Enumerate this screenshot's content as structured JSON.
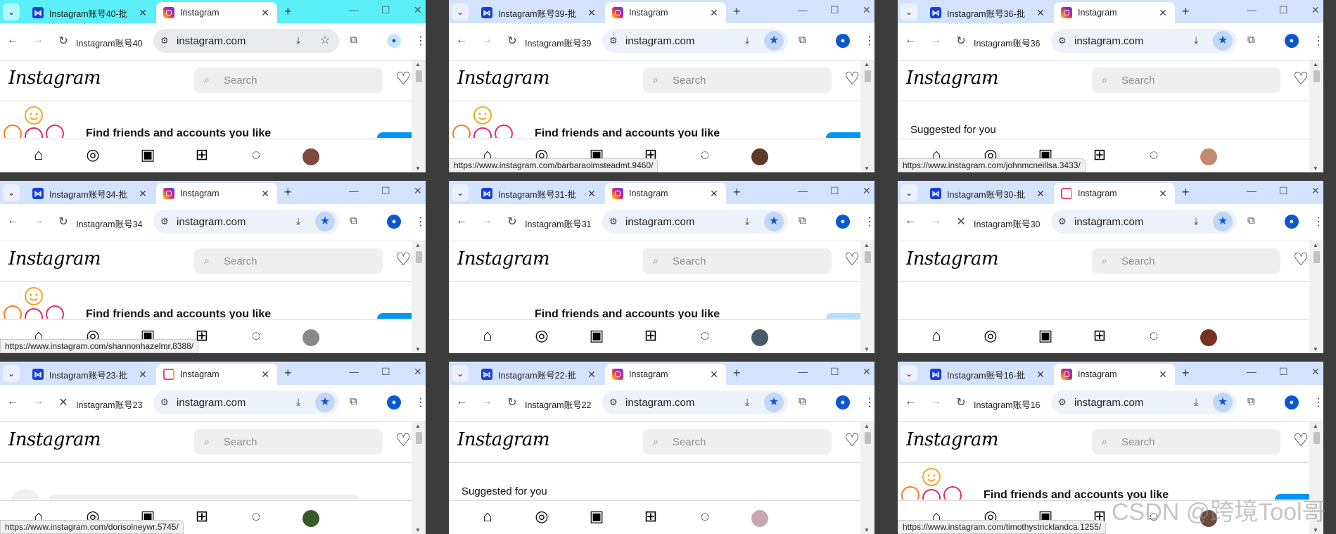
{
  "common": {
    "new_tab_glyph": "+",
    "close_glyph": "✕",
    "menu_glyph": "⌄",
    "back_glyph": "←",
    "forward_glyph": "→",
    "reload_glyph": "↻",
    "stop_glyph": "✕",
    "url": "instagram.com",
    "ig_logo": "Instagram",
    "search_placeholder": "Search",
    "find_friends": "Find friends and accounts you like",
    "suggested": "Suggested for you",
    "colors": {
      "tab_strip": "#d3e3fd",
      "active_strip": "#5bf0f8",
      "ig_blue": "#0095f6",
      "bookmark_blue": "#0b57d0"
    }
  },
  "windows": [
    {
      "inactive_tab": "Instagram账号40-批",
      "active_tab": "Instagram",
      "page_title": "Instagram账号40",
      "state": "friends",
      "status_url": "",
      "avatar": "#7a4a3c",
      "loading": false,
      "bookmarked": false
    },
    {
      "inactive_tab": "Instagram账号39-批",
      "active_tab": "Instagram",
      "page_title": "Instagram账号39",
      "state": "friends",
      "status_url": "https://www.instagram.com/barbaraolmsteadmt.9460/",
      "avatar": "#5a3a2a",
      "loading": false,
      "bookmarked": true
    },
    {
      "inactive_tab": "Instagram账号36-批",
      "active_tab": "Instagram",
      "page_title": "Instagram账号36",
      "state": "suggested",
      "status_url": "https://www.instagram.com/johnmcneillsa.3433/",
      "avatar": "#c48a70",
      "loading": false,
      "bookmarked": true
    },
    {
      "inactive_tab": "Instagram账号34-批",
      "active_tab": "Instagram",
      "page_title": "Instagram账号34",
      "state": "friends",
      "status_url": "https://www.instagram.com/shannonhazelmr.8388/",
      "avatar": "#8a8a8a",
      "loading": false,
      "bookmarked": true
    },
    {
      "inactive_tab": "Instagram账号31-批",
      "active_tab": "Instagram",
      "page_title": "Instagram账号31",
      "state": "friends-light",
      "status_url": "",
      "avatar": "#4a5a6a",
      "loading": false,
      "bookmarked": true
    },
    {
      "inactive_tab": "Instagram账号30-批",
      "active_tab": "Instagram",
      "page_title": "Instagram账号30",
      "state": "blank",
      "status_url": "",
      "avatar": "#7a3020",
      "loading": true,
      "bookmarked": true
    },
    {
      "inactive_tab": "Instagram账号23-批",
      "active_tab": "Instagram",
      "page_title": "Instagram账号23",
      "state": "skeleton",
      "status_url": "https://www.instagram.com/dorisolneywr.5745/",
      "avatar": "#3a5a2a",
      "loading": true,
      "bookmarked": true
    },
    {
      "inactive_tab": "Instagram账号22-批",
      "active_tab": "Instagram",
      "page_title": "Instagram账号22",
      "state": "suggested",
      "status_url": "",
      "avatar": "#c8a8b0",
      "loading": false,
      "bookmarked": true
    },
    {
      "inactive_tab": "Instagram账号16-批",
      "active_tab": "Instagram",
      "page_title": "Instagram账号16",
      "state": "friends",
      "status_url": "https://www.instagram.com/timothystricklandca.1255/",
      "avatar": "#6a4a3a",
      "loading": false,
      "bookmarked": true
    }
  ],
  "watermark": "CSDN @跨境Tool哥"
}
